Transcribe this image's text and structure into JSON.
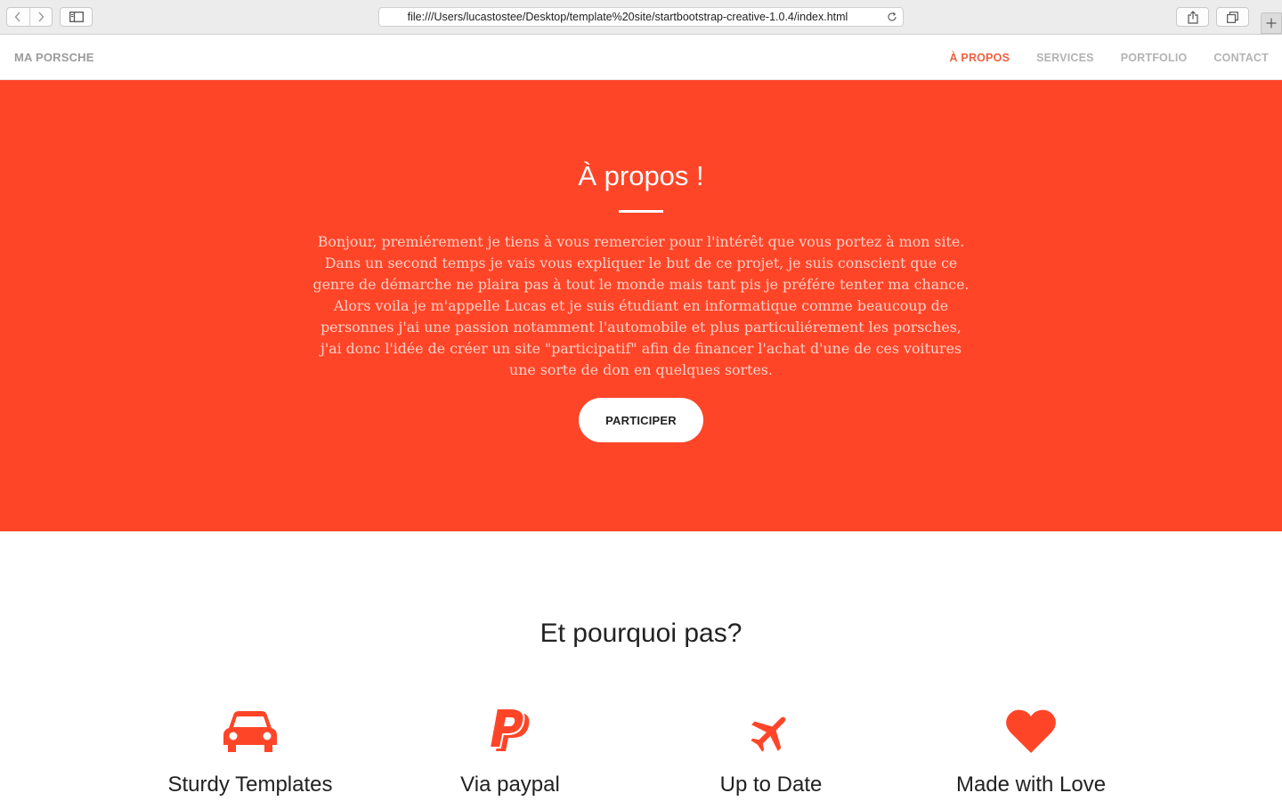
{
  "browser": {
    "url": "file:///Users/lucastostee/Desktop/template%20site/startbootstrap-creative-1.0.4/index.html",
    "icons": [
      "back-icon",
      "forward-icon",
      "sidebar-icon",
      "reload-icon",
      "share-icon",
      "tabs-icon",
      "plus-icon"
    ]
  },
  "nav": {
    "brand": "MA PORSCHE",
    "links": [
      "À PROPOS",
      "SERVICES",
      "PORTFOLIO",
      "CONTACT"
    ],
    "active": "À PROPOS"
  },
  "hero": {
    "title": "À propos !",
    "text": "Bonjour, premiérement je tiens à vous remercier pour l'intérêt que vous portez à mon site. Dans un second temps je vais vous expliquer le but de ce projet, je suis conscient que ce genre de démarche ne plaira pas à tout le monde mais tant pis je préfére tenter ma chance. Alors voila je m'appelle Lucas et je suis étudiant en informatique comme beaucoup de personnes j'ai une passion notamment l'automobile et plus particuliérement les porsches, j'ai donc l'idée de créer un site \"participatif\" afin de financer l'achat d'une de ces voitures une sorte de don en quelques sortes.",
    "button": "PARTICIPER"
  },
  "services": {
    "title": "Et pourquoi pas?",
    "items": [
      {
        "label": "Sturdy Templates",
        "icon": "car-icon"
      },
      {
        "label": "Via paypal",
        "icon": "paypal-icon"
      },
      {
        "label": "Up to Date",
        "icon": "plane-icon"
      },
      {
        "label": "Made with Love",
        "icon": "heart-icon"
      }
    ]
  },
  "colors": {
    "accent": "#f05f40",
    "hero_bg": "#ff4528",
    "icon": "#ff4528"
  }
}
